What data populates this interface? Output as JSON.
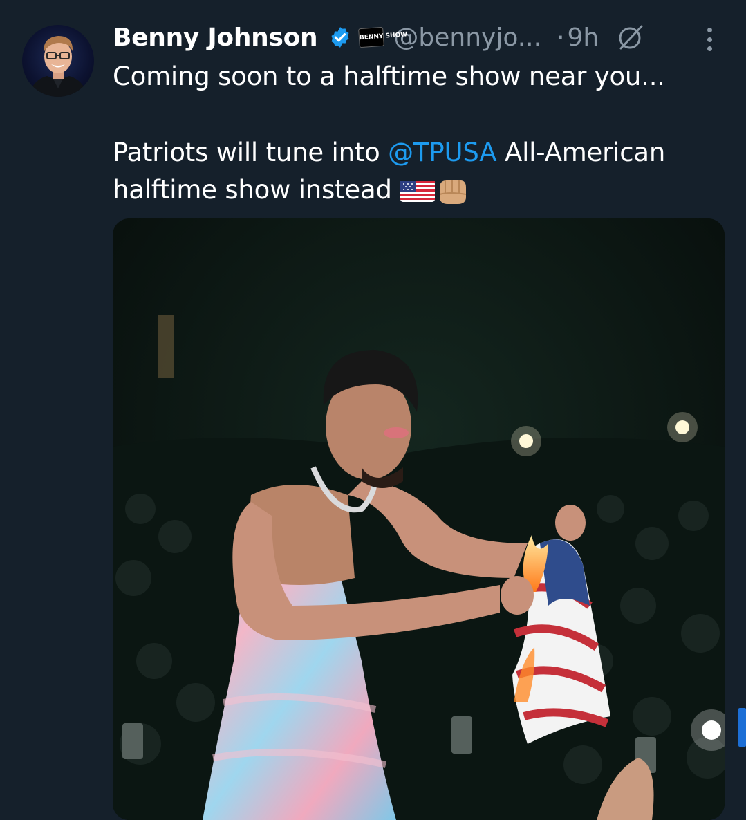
{
  "tweet": {
    "author_name": "Benny Johnson",
    "affiliate_badge_text": "BENNY SHOW",
    "handle": "@bennyjo...",
    "separator": "·",
    "time": "9h",
    "text_line1": "Coming soon to a halftime show near you...",
    "text_line2_before": "Patriots will tune into ",
    "mention": "@TPUSA",
    "text_line2_after": " All-American",
    "text_line3": "halftime show instead",
    "emojis": [
      "us-flag-emoji",
      "fist-bump-emoji"
    ]
  },
  "icons": {
    "verified": "verified-badge-icon",
    "grok": "grok-icon",
    "more": "more-options-icon"
  },
  "colors": {
    "background": "#15202b",
    "text": "#ffffff",
    "muted": "#8b98a5",
    "accent": "#1d9bf0"
  }
}
